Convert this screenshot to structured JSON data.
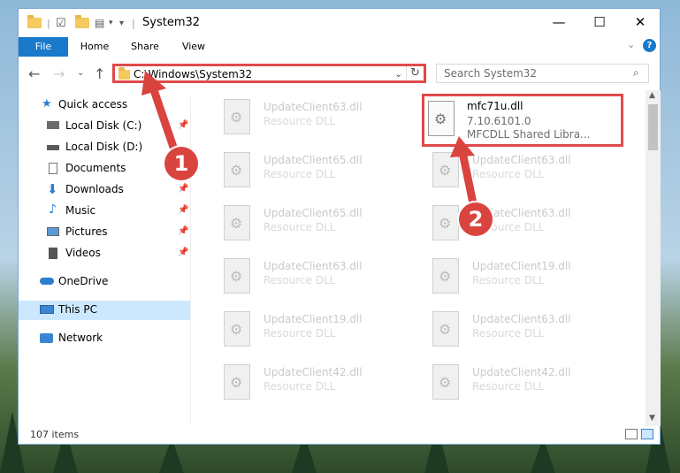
{
  "window": {
    "title": "System32",
    "controls": {
      "minimize": "—",
      "maximize": "☐",
      "close": "✕"
    }
  },
  "ribbon": {
    "tabs": [
      {
        "label": "File"
      },
      {
        "label": "Home"
      },
      {
        "label": "Share"
      },
      {
        "label": "View"
      }
    ]
  },
  "navigation": {
    "address": "C:\\Windows\\System32",
    "search_placeholder": "Search System32"
  },
  "sidebar": {
    "items": [
      {
        "label": "Quick access",
        "icon": "star-icon",
        "pinned": false
      },
      {
        "label": "Local Disk (C:)",
        "icon": "drive-icon",
        "pinned": true
      },
      {
        "label": "Local Disk (D:)",
        "icon": "drive-icon",
        "pinned": false
      },
      {
        "label": "Documents",
        "icon": "document-icon",
        "pinned": true
      },
      {
        "label": "Downloads",
        "icon": "download-icon",
        "pinned": true
      },
      {
        "label": "Music",
        "icon": "music-icon",
        "pinned": true
      },
      {
        "label": "Pictures",
        "icon": "picture-icon",
        "pinned": true
      },
      {
        "label": "Videos",
        "icon": "video-icon",
        "pinned": true
      },
      {
        "label": "OneDrive",
        "icon": "cloud-icon",
        "pinned": false
      },
      {
        "label": "This PC",
        "icon": "computer-icon",
        "pinned": false,
        "selected": true
      },
      {
        "label": "Network",
        "icon": "network-icon",
        "pinned": false
      }
    ]
  },
  "files": {
    "left_column": [
      {
        "name": "UpdateClient63.dll",
        "type": "Resource DLL"
      },
      {
        "name": "UpdateClient65.dll",
        "type": "Resource DLL"
      },
      {
        "name": "UpdateClient65.dll",
        "type": "Resource DLL"
      },
      {
        "name": "UpdateClient63.dll",
        "type": "Resource DLL"
      },
      {
        "name": "UpdateClient19.dll",
        "type": "Resource DLL"
      },
      {
        "name": "UpdateClient42.dll",
        "type": "Resource DLL"
      }
    ],
    "right_column": [
      {
        "name": "mfc71u.dll",
        "type": "7.10.6101.0",
        "desc": "MFCDLL Shared Libra...",
        "highlighted": true
      },
      {
        "name": "UpdateClient63.dll",
        "type": "Resource DLL"
      },
      {
        "name": "UpdateClient63.dll",
        "type": "Resource DLL"
      },
      {
        "name": "UpdateClient19.dll",
        "type": "Resource DLL"
      },
      {
        "name": "UpdateClient63.dll",
        "type": "Resource DLL"
      },
      {
        "name": "UpdateClient42.dll",
        "type": "Resource DLL"
      }
    ]
  },
  "status": {
    "item_count": "107 items"
  },
  "annotations": {
    "step1": "1",
    "step2": "2"
  },
  "colors": {
    "accent": "#1979ca",
    "highlight": "#e04a4a",
    "selected": "#cce8ff"
  }
}
